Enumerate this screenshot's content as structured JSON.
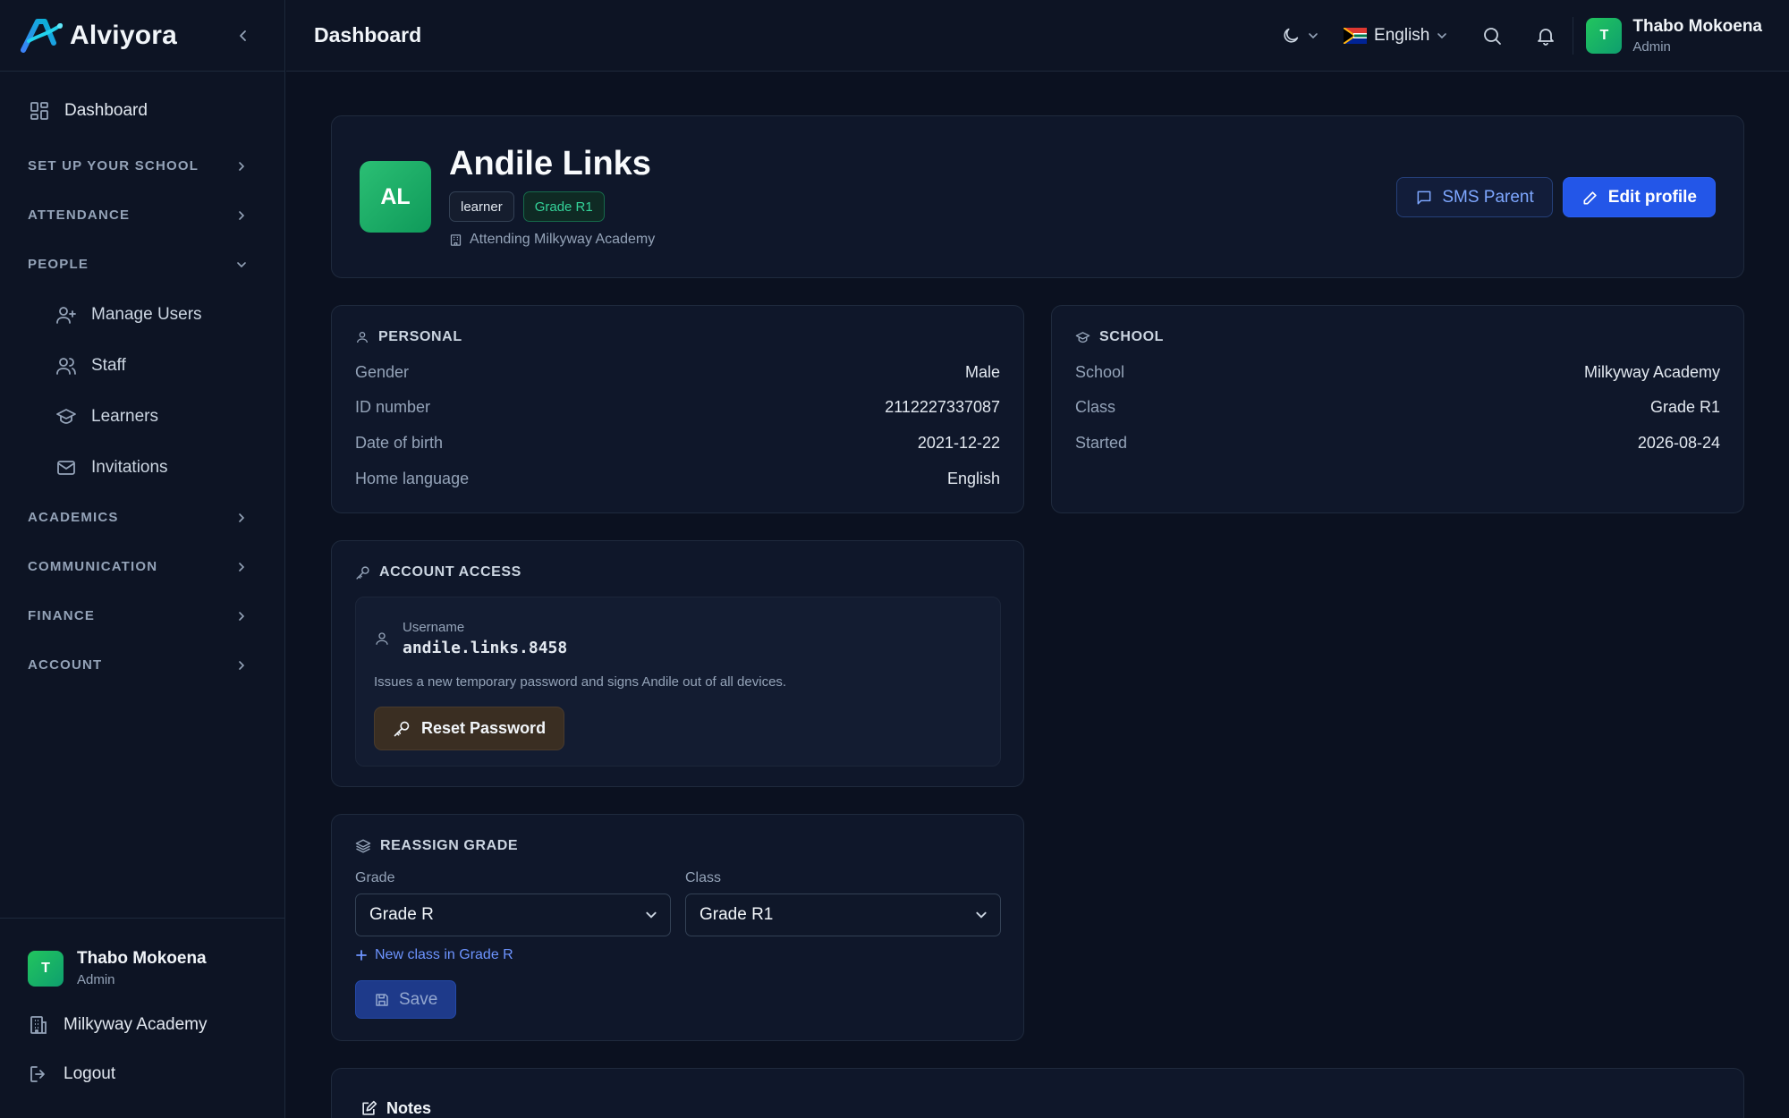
{
  "brand": {
    "name": "Alviyora"
  },
  "sidebar": {
    "dashboard_label": "Dashboard",
    "sections": [
      {
        "label": "SET UP YOUR SCHOOL"
      },
      {
        "label": "ATTENDANCE"
      },
      {
        "label": "PEOPLE"
      },
      {
        "label": "ACADEMICS"
      },
      {
        "label": "COMMUNICATION"
      },
      {
        "label": "FINANCE"
      },
      {
        "label": "ACCOUNT"
      }
    ],
    "people_items": [
      {
        "label": "Manage Users"
      },
      {
        "label": "Staff"
      },
      {
        "label": "Learners"
      },
      {
        "label": "Invitations"
      }
    ],
    "footer": {
      "user_initial": "T",
      "user_name": "Thabo Mokoena",
      "user_role": "Admin",
      "school": "Milkyway Academy",
      "logout": "Logout"
    }
  },
  "topbar": {
    "title": "Dashboard",
    "language": "English",
    "user_initial": "T",
    "user_name": "Thabo Mokoena",
    "user_role": "Admin"
  },
  "profile": {
    "initials": "AL",
    "name": "Andile Links",
    "role_badge": "learner",
    "grade_badge": "Grade R1",
    "attending": "Attending Milkyway Academy",
    "sms_button": "SMS Parent",
    "edit_button": "Edit profile"
  },
  "personal": {
    "title": "PERSONAL",
    "rows": [
      {
        "label": "Gender",
        "value": "Male"
      },
      {
        "label": "ID number",
        "value": "2112227337087"
      },
      {
        "label": "Date of birth",
        "value": "2021-12-22"
      },
      {
        "label": "Home language",
        "value": "English"
      }
    ]
  },
  "school": {
    "title": "SCHOOL",
    "rows": [
      {
        "label": "School",
        "value": "Milkyway Academy"
      },
      {
        "label": "Class",
        "value": "Grade R1"
      },
      {
        "label": "Started",
        "value": "2026-08-24"
      }
    ]
  },
  "account_access": {
    "title": "ACCOUNT ACCESS",
    "username_label": "Username",
    "username": "andile.links.8458",
    "description": "Issues a new temporary password and signs Andile out of all devices.",
    "reset_button": "Reset Password"
  },
  "reassign": {
    "title": "REASSIGN GRADE",
    "grade_label": "Grade",
    "grade_value": "Grade R",
    "class_label": "Class",
    "class_value": "Grade R1",
    "new_class_link": "New class in Grade R",
    "save_button": "Save"
  },
  "notes": {
    "title": "Notes"
  },
  "colors": {
    "background": "#0b1120",
    "accent_blue": "#2356e8",
    "accent_green": "#22c55e"
  }
}
